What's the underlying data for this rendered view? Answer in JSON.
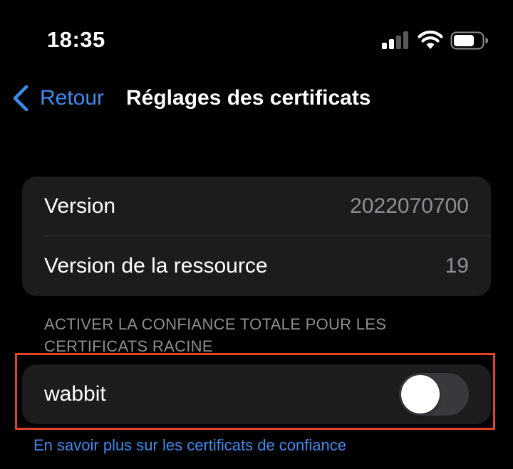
{
  "status_bar": {
    "time": "18:35",
    "icons": [
      "signal-icon",
      "wifi-icon",
      "battery-icon"
    ]
  },
  "nav": {
    "back_label": "Retour",
    "title": "Réglages des certificats"
  },
  "info_group": {
    "rows": [
      {
        "label": "Version",
        "value": "2022070700"
      },
      {
        "label": "Version de la ressource",
        "value": "19"
      }
    ]
  },
  "trust_section": {
    "header": "ACTIVER LA CONFIANCE TOTALE POUR LES CERTIFICATS RACINE",
    "rows": [
      {
        "label": "wabbit",
        "toggle_on": false
      }
    ]
  },
  "footer": {
    "link": "En savoir plus sur les certificats de confiance"
  },
  "colors": {
    "background": "#000000",
    "cell": "#1c1c1e",
    "accent_blue": "#3b8df0",
    "secondary_text": "#8e8e93",
    "toggle_off": "#39393d",
    "highlight": "#e0422b"
  }
}
